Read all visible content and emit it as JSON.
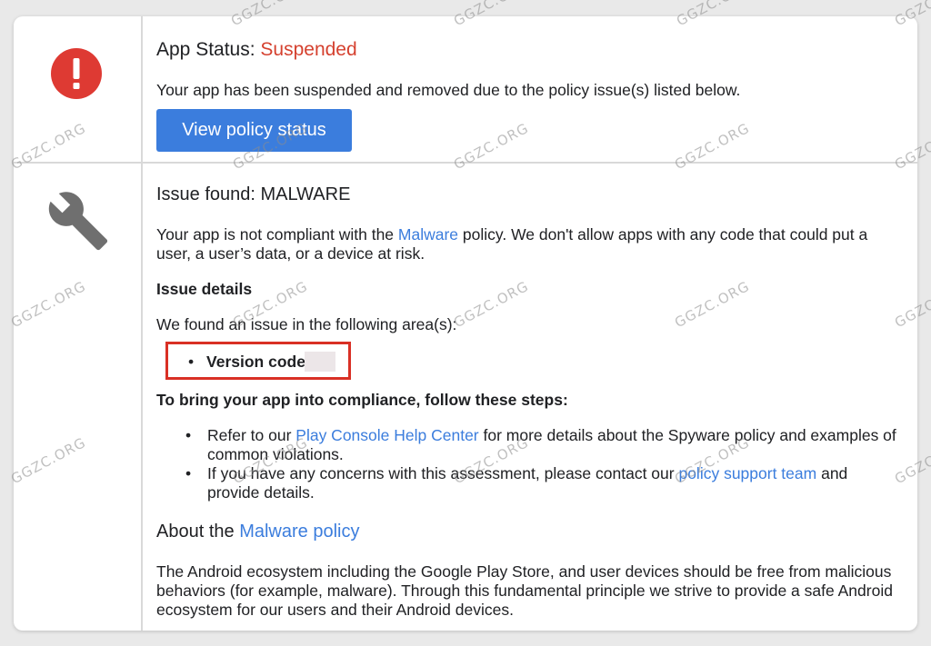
{
  "status": {
    "label": "App Status: ",
    "value": "Suspended",
    "description": "Your app has been suspended and removed due to the policy issue(s) listed below.",
    "button_label": "View policy status"
  },
  "issue": {
    "title": "Issue found: MALWARE",
    "intro_before": "Your app is not compliant with the ",
    "intro_link": "Malware",
    "intro_after": " policy. We don't allow apps with any code that could put a user, a user’s data, or a device at risk.",
    "details_heading": "Issue details",
    "area_text": "We found an issue in the following area(s):",
    "version_label": "Version code",
    "steps_heading": "To bring your app into compliance, follow these steps:",
    "step1_before": "Refer to our ",
    "step1_link": "Play Console Help Center",
    "step1_after": " for more details about the Spyware policy and examples of common violations.",
    "step2_before": "If you have any concerns with this assessment, please contact our ",
    "step2_link": "policy support team",
    "step2_after": " and provide details."
  },
  "about": {
    "title_before": "About the ",
    "title_link": "Malware policy",
    "text": "The Android ecosystem including the Google Play Store, and user devices should be free from malicious behaviors (for example, malware). Through this fundamental principle we strive to provide a safe Android ecosystem for our users and their Android devices."
  },
  "watermark": {
    "text": "GGZC.ORG"
  },
  "icons": {
    "alert": "alert-icon",
    "wrench": "wrench-icon"
  },
  "colors": {
    "accent": "#3b7ddd",
    "danger": "#d5412f",
    "alert_red": "#de3a33",
    "wrench_gray": "#6f6f6f"
  }
}
